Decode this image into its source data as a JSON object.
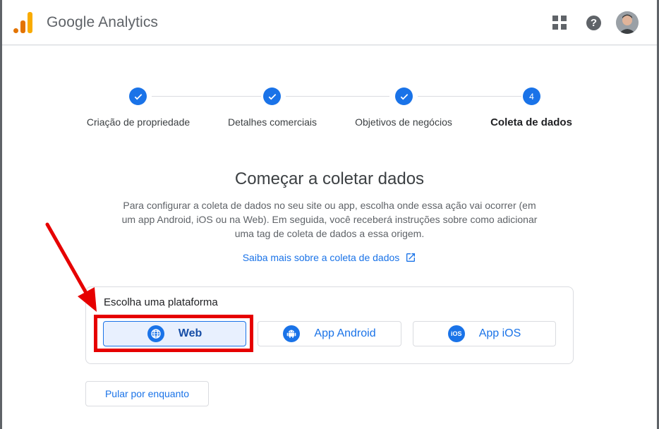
{
  "header": {
    "app_title": "Google Analytics",
    "apps_icon": "apps-grid-icon",
    "help_icon": "help-icon",
    "help_glyph": "?",
    "avatar_icon": "user-avatar"
  },
  "stepper": {
    "steps": [
      {
        "label": "Criação de propriedade",
        "state": "done"
      },
      {
        "label": "Detalhes comerciais",
        "state": "done"
      },
      {
        "label": "Objetivos de negócios",
        "state": "done"
      },
      {
        "label": "Coleta de dados",
        "state": "active",
        "number": "4"
      }
    ]
  },
  "main": {
    "heading": "Começar a coletar dados",
    "description": "Para configurar a coleta de dados no seu site ou app, escolha onde essa ação vai ocorrer (em um app Android, iOS ou na Web). Em seguida, você receberá instruções sobre como adicionar uma tag de coleta de dados a essa origem.",
    "learn_more": "Saiba mais sobre a coleta de dados"
  },
  "platform": {
    "title": "Escolha uma plataforma",
    "options": [
      {
        "label": "Web",
        "icon": "globe-icon",
        "selected": true
      },
      {
        "label": "App Android",
        "icon": "android-icon",
        "selected": false
      },
      {
        "label": "App iOS",
        "icon": "ios-icon",
        "selected": false,
        "icon_text": "iOS"
      }
    ]
  },
  "skip": {
    "label": "Pular por enquanto"
  },
  "colors": {
    "accent": "#1a73e8",
    "annotation": "#e60000"
  }
}
